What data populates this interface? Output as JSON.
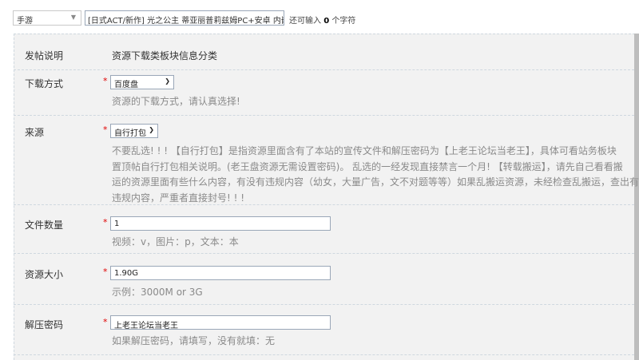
{
  "top": {
    "category_select": "手游",
    "title_value": "[日式ACT/新作] 光之公主 蒂亚丽普莉兹姆PC+安卓 内嵌/",
    "remain_prefix": "还可输入",
    "remain_count": "0",
    "remain_suffix": "个字符"
  },
  "form": {
    "post_info": {
      "label": "发帖说明",
      "value": "资源下载类板块信息分类"
    },
    "required_mark": "*",
    "download_method": {
      "label": "下载方式",
      "selected": "百度盘",
      "hint": "资源的下载方式，请认真选择!"
    },
    "source": {
      "label": "来源",
      "selected": "自行打包",
      "desc_lines": [
        "不要乱选! ! ! 【自行打包】是指资源里面含有了本站的宣传文件和解压密码为【上老王论坛当老王】，具体可看站务板块",
        "置顶帖自行打包相关说明。(老王盘资源无需设置密码)。 乱选的一经发现直接禁言一个月! 【转载搬运】，请先自己看看搬",
        "运的资源里面有些什么内容，有没有违规内容（幼女，大量广告，文不对题等等）如果乱搬运资源，未经检查乱搬运，查出有",
        "违规内容，严重者直接封号! ! !"
      ]
    },
    "file_count": {
      "label": "文件数量",
      "value": "1",
      "hint": "视频：v，图片：p，文本：本"
    },
    "resource_size": {
      "label": "资源大小",
      "value": "1.90G",
      "hint": "示例：3000M or 3G"
    },
    "unzip_password": {
      "label": "解压密码",
      "value": "上老王论坛当老王",
      "hint": "如果解压密码，请填写，没有就填：无"
    }
  }
}
